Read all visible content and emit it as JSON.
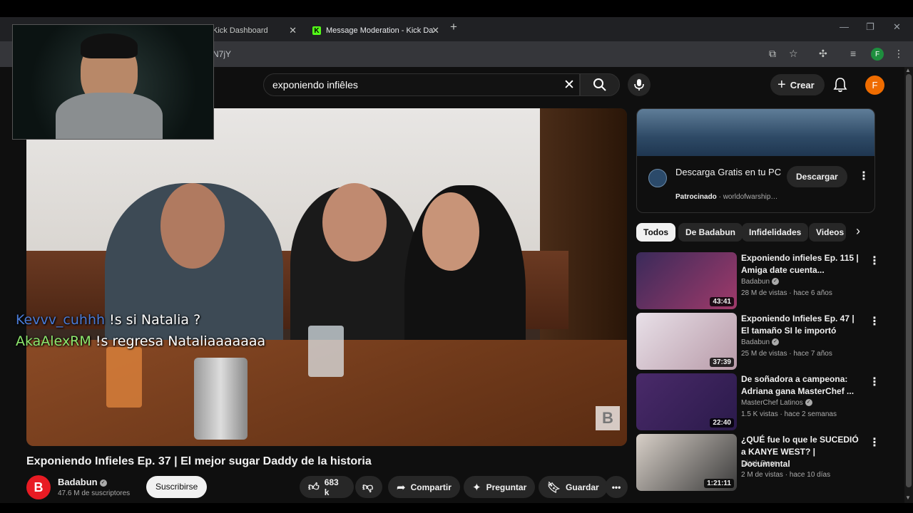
{
  "browser": {
    "tabs": [
      {
        "label": "Kick Dashboard",
        "active": false
      },
      {
        "label": "Message Moderation - Kick Da",
        "active": true
      }
    ],
    "url_fragment": "N7jY"
  },
  "header": {
    "search_value": "exponiendo infiêles",
    "create_label": "Crear",
    "avatar_letter": "F"
  },
  "chat": [
    {
      "user": "Kevvv_cuhhh",
      "message": "!s si Natalia ?"
    },
    {
      "user": "AkaAlexRM",
      "message": "!s regresa Nataliaaaaaaa"
    }
  ],
  "video": {
    "title": "Exponiendo Infieles Ep. 37 | El mejor sugar Daddy de la historia",
    "watermark": "B",
    "channel": {
      "name": "Badabun",
      "subscribers": "47.6 M de suscriptores",
      "avatar_letter": "B"
    },
    "subscribe_label": "Suscribirse",
    "likes": "683 k",
    "share_label": "Compartir",
    "ask_label": "Preguntar",
    "save_label": "Guardar"
  },
  "ad": {
    "title": "Descarga Gratis en tu PC",
    "sponsored": "Patrocinado",
    "advertiser": "worldofwarship…",
    "button": "Descargar"
  },
  "chips": [
    "Todos",
    "De Badabun",
    "Infidelidades",
    "Videos"
  ],
  "recommendations": [
    {
      "title": "Exponiendo infieles Ep. 115 | Amiga date cuenta...",
      "channel": "Badabun",
      "views": "28 M de vistas",
      "age": "hace 6 años",
      "duration": "43:41"
    },
    {
      "title": "Exponiendo Infieles Ep. 47 | El tamaño SI le importó",
      "channel": "Badabun",
      "views": "25 M de vistas",
      "age": "hace 7 años",
      "duration": "37:39"
    },
    {
      "title": "De soñadora a campeona: Adriana gana MasterChef ...",
      "channel": "MasterChef Latinos",
      "views": "1.5 K vistas",
      "age": "hace 2 semanas",
      "duration": "22:40"
    },
    {
      "title": "¿QUÉ fue lo que le SUCEDIÓ a KANYE WEST? | Documental",
      "channel": "Dieck Docs",
      "views": "2 M de vistas",
      "age": "hace 10 días",
      "duration": "1:21:11"
    }
  ],
  "colors": {
    "brand_red": "#e81b23",
    "kick_green": "#53fc18",
    "chat_user1": "#4a7bd6",
    "chat_user2": "#8ee86e"
  }
}
